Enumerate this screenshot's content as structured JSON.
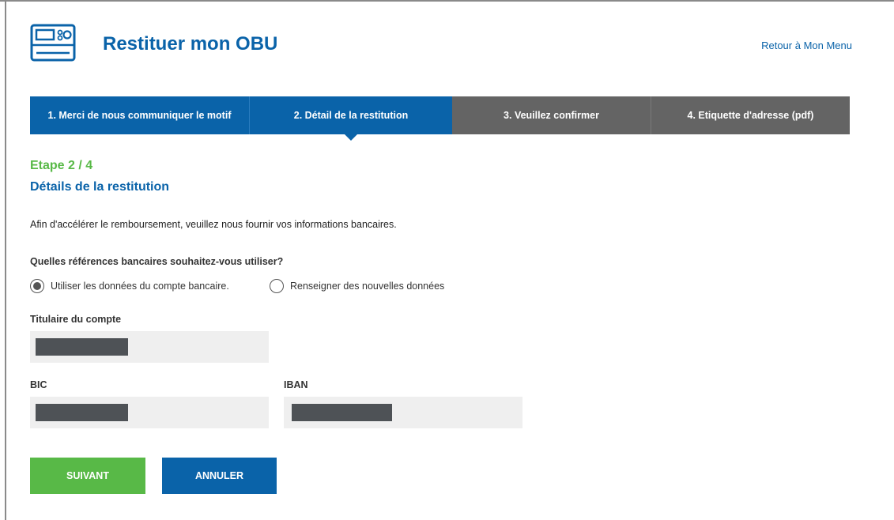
{
  "header": {
    "title": "Restituer mon OBU",
    "back_link": "Retour à Mon Menu",
    "icon": "obu-device-icon"
  },
  "steps": [
    {
      "label": "1. Merci de nous communiquer le motif",
      "state": "done"
    },
    {
      "label": "2. Détail de la restitution",
      "state": "active"
    },
    {
      "label": "3. Veuillez confirmer",
      "state": "pending"
    },
    {
      "label": "4. Etiquette d'adresse (pdf)",
      "state": "pending"
    }
  ],
  "main": {
    "step_count": "Etape 2 / 4",
    "section_title": "Détails de la restitution",
    "intro": "Afin d'accélérer le remboursement, veuillez nous fournir vos informations bancaires.",
    "question": "Quelles références bancaires souhaitez-vous utiliser?",
    "radio_options": [
      {
        "label": "Utiliser les données du compte bancaire.",
        "selected": true
      },
      {
        "label": "Renseigner des nouvelles données",
        "selected": false
      }
    ],
    "fields": {
      "holder_label": "Titulaire du compte",
      "bic_label": "BIC",
      "iban_label": "IBAN"
    }
  },
  "buttons": {
    "next": "SUIVANT",
    "cancel": "ANNULER"
  },
  "colors": {
    "brand_blue": "#0a63a9",
    "accent_green": "#58b947",
    "step_inactive": "#646464",
    "field_bg": "#efefef",
    "mask": "#4e5256"
  }
}
